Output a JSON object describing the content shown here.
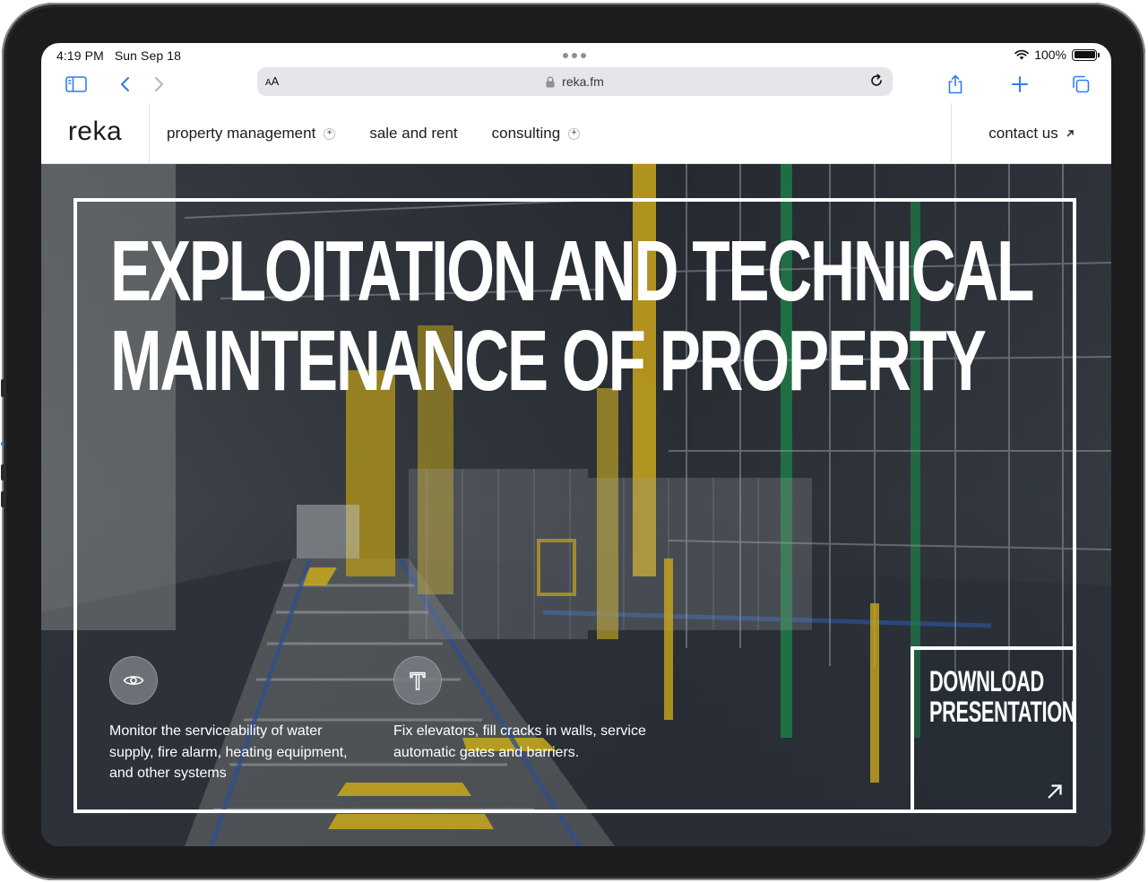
{
  "status_bar": {
    "time": "4:19 PM",
    "date": "Sun Sep 18",
    "battery": "100%"
  },
  "browser": {
    "url": "reka.fm",
    "text_size_button": {
      "small": "A",
      "large": "A"
    },
    "icons": [
      "sidebar-icon",
      "back-icon",
      "forward-icon",
      "lock-icon",
      "reload-icon",
      "share-icon",
      "new-tab-icon",
      "tabs-icon"
    ]
  },
  "site": {
    "logo": "reka",
    "nav": [
      {
        "label": "property management",
        "has_plus": true
      },
      {
        "label": "sale and rent",
        "has_plus": false
      },
      {
        "label": "consulting",
        "has_plus": true
      }
    ],
    "contact": "contact us"
  },
  "hero": {
    "headline_line1": "EXPLOITATION AND TECHNICAL",
    "headline_line2": "MAINTENANCE OF PROPERTY",
    "features": [
      {
        "icon": "eye-icon",
        "text": "Monitor the serviceability of water supply, fire alarm, heating equipment, and other systems"
      },
      {
        "icon": "hammer-icon",
        "text": "Fix elevators, fill cracks in walls, service automatic gates and barriers."
      }
    ],
    "download_label": "DOWNLOAD\nPRESENTATION"
  },
  "colors": {
    "accent_yellow": "#d7b21f",
    "frame_white": "#ffffff",
    "text_dark": "#1b1b1b"
  }
}
